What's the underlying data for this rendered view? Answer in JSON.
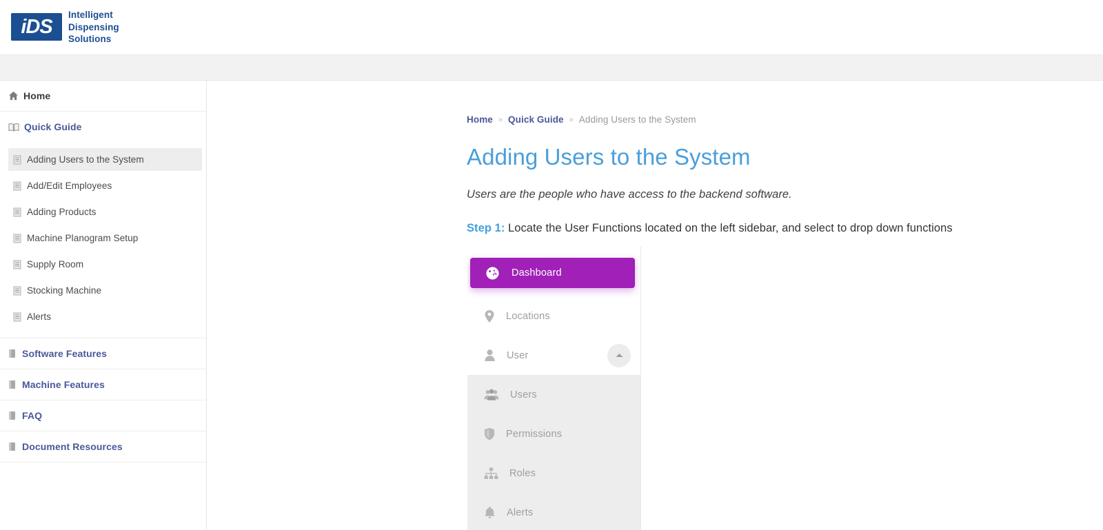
{
  "header": {
    "logo_mark_text": "iDS",
    "logo_line1": "Intelligent",
    "logo_line2": "Dispensing",
    "logo_line3": "Solutions",
    "brand_color": "#1b4f91"
  },
  "sidebar": {
    "home": {
      "label": "Home",
      "icon": "home-icon"
    },
    "sections": [
      {
        "label": "Quick Guide",
        "icon": "open-book-icon",
        "expanded": true,
        "items": [
          {
            "label": "Adding Users to the System",
            "icon": "document-icon",
            "active": true
          },
          {
            "label": "Add/Edit Employees",
            "icon": "document-icon",
            "active": false
          },
          {
            "label": "Adding Products",
            "icon": "document-icon",
            "active": false
          },
          {
            "label": "Machine Planogram Setup",
            "icon": "document-icon",
            "active": false
          },
          {
            "label": "Supply Room",
            "icon": "document-icon",
            "active": false
          },
          {
            "label": "Stocking Machine",
            "icon": "document-icon",
            "active": false
          },
          {
            "label": "Alerts",
            "icon": "document-icon",
            "active": false
          }
        ]
      },
      {
        "label": "Software Features",
        "icon": "closed-book-icon",
        "expanded": false,
        "items": []
      },
      {
        "label": "Machine Features",
        "icon": "closed-book-icon",
        "expanded": false,
        "items": []
      },
      {
        "label": "FAQ",
        "icon": "closed-book-icon",
        "expanded": false,
        "items": []
      },
      {
        "label": "Document Resources",
        "icon": "closed-book-icon",
        "expanded": false,
        "items": []
      }
    ]
  },
  "main": {
    "breadcrumb": {
      "home": "Home",
      "separator": "»",
      "section": "Quick Guide",
      "current": "Adding Users to the System"
    },
    "title": "Adding Users to the System",
    "title_color": "#4a9fd8",
    "lede": "Users are the people who have access to the backend software.",
    "step": {
      "label": "Step 1:",
      "label_color": "#3fa0e0",
      "text": " Locate the User Functions located on the left sidebar, and select to drop down functions"
    },
    "embedded_screenshot": {
      "accent_color": "#a020b8",
      "items": [
        {
          "label": "Dashboard",
          "icon": "dashboard-gauge-icon",
          "state": "active"
        },
        {
          "label": "Locations",
          "icon": "map-pin-icon",
          "state": "normal"
        },
        {
          "label": "User",
          "icon": "user-icon",
          "state": "expanded"
        },
        {
          "label": "Users",
          "icon": "users-group-icon",
          "state": "sub"
        },
        {
          "label": "Permissions",
          "icon": "shield-icon",
          "state": "sub"
        },
        {
          "label": "Roles",
          "icon": "org-chart-icon",
          "state": "sub"
        },
        {
          "label": "Alerts",
          "icon": "bell-icon",
          "state": "sub"
        }
      ]
    }
  }
}
